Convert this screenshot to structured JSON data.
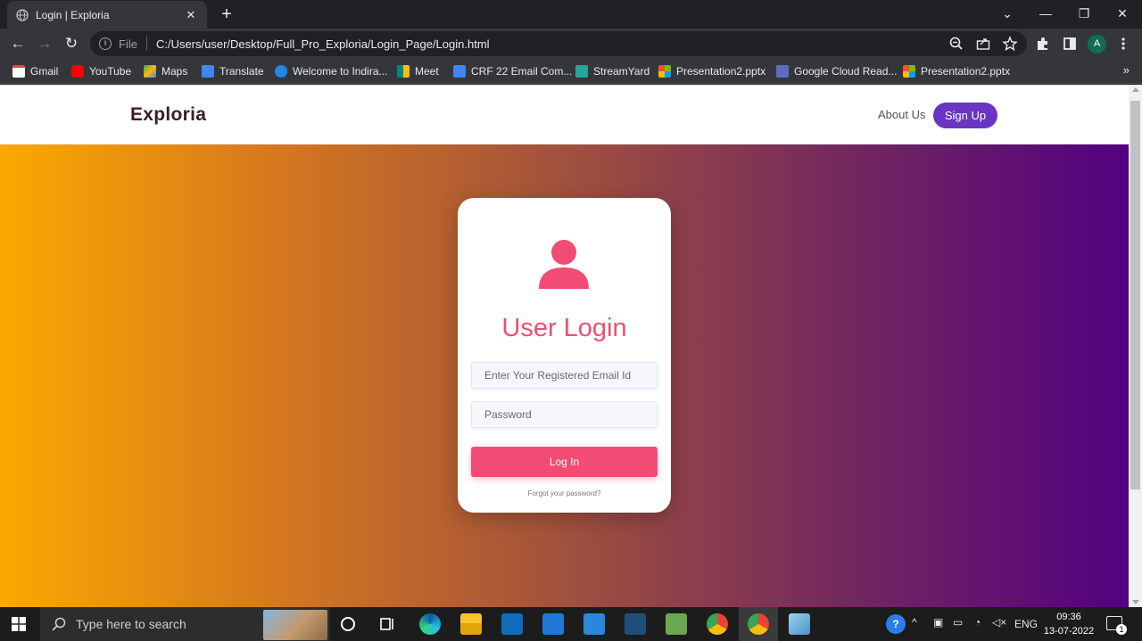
{
  "browser": {
    "tab_title": "Login | Exploria",
    "tab_close": "✕",
    "new_tab": "+",
    "window_controls": {
      "minimize": "—",
      "restore": "❐",
      "close": "✕",
      "tab_search": "⌄"
    },
    "nav": {
      "back": "←",
      "forward": "→",
      "reload": "↻"
    },
    "address": {
      "scheme_label": "File",
      "url": "C:/Users/user/Desktop/Full_Pro_Exploria/Login_Page/Login.html"
    },
    "profile_initial": "A",
    "bookmarks": [
      {
        "label": "Gmail",
        "color": "#ea4335"
      },
      {
        "label": "YouTube",
        "color": "#ff0000"
      },
      {
        "label": "Maps",
        "color": "#34a853"
      },
      {
        "label": "Translate",
        "color": "#4285f4"
      },
      {
        "label": "Welcome to Indira...",
        "color": "#1e88e5"
      },
      {
        "label": "Meet",
        "color": "#00897b"
      },
      {
        "label": "CRF 22 Email Com...",
        "color": "#4285f4"
      },
      {
        "label": "StreamYard",
        "color": "#26a69a"
      },
      {
        "label": "Presentation2.pptx",
        "color": "#f25022"
      },
      {
        "label": "Google Cloud Read...",
        "color": "#5c6bc0"
      },
      {
        "label": "Presentation2.pptx",
        "color": "#f25022"
      }
    ],
    "bookmarks_more": "»"
  },
  "site": {
    "brand": "Exploria",
    "nav": {
      "about": "About Us",
      "signup": "Sign Up"
    },
    "login": {
      "title": "User Login",
      "email_placeholder": "Enter Your Registered Email Id",
      "password_placeholder": "Password",
      "submit": "Log In",
      "forgot": "Forgot your password?"
    },
    "colors": {
      "accent": "#f24c74",
      "signup": "#6a35c2",
      "gradient_start": "#fca800",
      "gradient_end": "#520180"
    }
  },
  "taskbar": {
    "search_placeholder": "Type here to search",
    "language": "ENG",
    "time": "09:36",
    "date": "13-07-2022",
    "notification_count": "1"
  }
}
